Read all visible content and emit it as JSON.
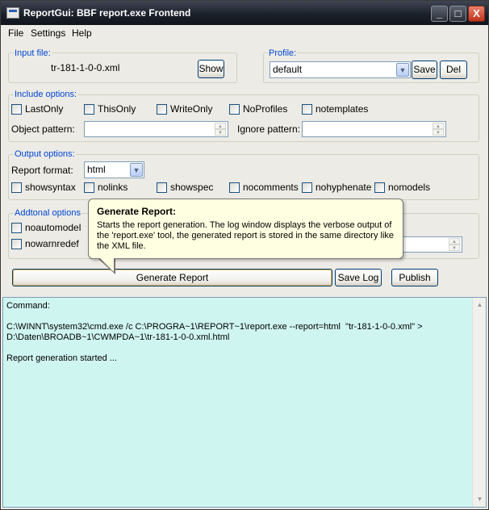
{
  "window": {
    "title": "ReportGui: BBF report.exe Frontend",
    "minimize": "_",
    "maximize": "□",
    "close": "X"
  },
  "menu": {
    "file": "File",
    "settings": "Settings",
    "help": "Help"
  },
  "input_file": {
    "label": "Input file:",
    "value": "tr-181-1-0-0.xml",
    "show_button": "Show"
  },
  "profile": {
    "label": "Profile:",
    "selected": "default",
    "save_button": "Save",
    "del_button": "Del"
  },
  "include_options": {
    "label": "Include options:",
    "checkboxes": [
      "LastOnly",
      "ThisOnly",
      "WriteOnly",
      "NoProfiles",
      "notemplates"
    ],
    "object_pattern_label": "Object pattern:",
    "object_pattern_value": "",
    "ignore_pattern_label": "Ignore pattern:",
    "ignore_pattern_value": ""
  },
  "output_options": {
    "label": "Output options:",
    "report_format_label": "Report format:",
    "report_format_value": "html",
    "checkboxes": [
      "showsyntax",
      "nolinks",
      "showspec",
      "nocomments",
      "nohyphenate",
      "nomodels"
    ]
  },
  "additional_options": {
    "label": "Addtonal options",
    "checkboxes": [
      "noautomodel",
      "nowarnredef"
    ]
  },
  "tooltip": {
    "title": "Generate Report:",
    "body": "Starts the report generation. The log window displays the verbose output of the 'report.exe' tool, the generated report is stored in the same directory like the XML file."
  },
  "actions": {
    "generate": "Generate Report",
    "save_log": "Save Log",
    "publish": "Publish"
  },
  "log": {
    "lines": [
      "Command:",
      "",
      "C:\\WINNT\\system32\\cmd.exe /c C:\\PROGRA~1\\REPORT~1\\report.exe --report=html  \"tr-181-1-0-0.xml\" >",
      "D:\\Daten\\BROADB~1\\CWMPDA~1\\tr-181-1-0-0.xml.html",
      "",
      "Report generation started ..."
    ]
  }
}
